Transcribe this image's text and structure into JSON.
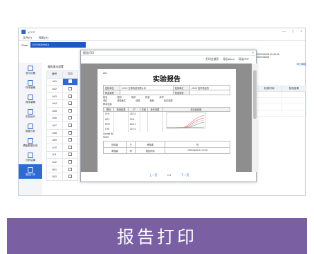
{
  "app": {
    "title": "qPCR",
    "window_controls": [
      "—",
      "□",
      "×"
    ],
    "menu": [
      "文件(F)",
      "帮助(H)"
    ],
    "barcode_label": "Plate",
    "barcode_value": "2022060894601"
  },
  "sidebar": {
    "items": [
      {
        "label": "显示设置",
        "active": false
      },
      {
        "label": "样本编辑",
        "active": false
      },
      {
        "label": "程序编辑",
        "active": false
      },
      {
        "label": "实验运行",
        "active": false
      },
      {
        "label": "数据分析",
        "active": false
      },
      {
        "label": "模板数据分析",
        "active": false
      },
      {
        "label": "分析结果",
        "active": false
      },
      {
        "label": "报告打印",
        "active": true
      }
    ]
  },
  "wells": {
    "header": "报告显示设置",
    "col_well": "编号",
    "col_print": "打印",
    "rows": [
      {
        "id": "A01",
        "selected": true
      },
      {
        "id": "A02",
        "selected": false
      },
      {
        "id": "A03",
        "selected": false
      },
      {
        "id": "A04",
        "selected": false
      },
      {
        "id": "A05",
        "selected": false
      },
      {
        "id": "A06",
        "selected": false
      },
      {
        "id": "A07",
        "selected": false
      },
      {
        "id": "A08",
        "selected": false
      },
      {
        "id": "A09",
        "selected": false
      },
      {
        "id": "A10",
        "selected": false
      },
      {
        "id": "A11",
        "selected": false
      },
      {
        "id": "A12",
        "selected": false
      },
      {
        "id": "B01",
        "selected": false
      },
      {
        "id": "B02",
        "selected": false
      }
    ]
  },
  "right_panel": {
    "timestamp_1": "2022/06/08 09:45:39",
    "timestamp_2": "2022/06/08",
    "print_label": "导出模板",
    "col_a": "检测时间",
    "col_b": "检测结果"
  },
  "dialog": {
    "title": "报告打印",
    "close": "×",
    "toolbar": [
      "打印全部页",
      "导出Word",
      "导出PDF"
    ],
    "page_header": "A01",
    "doc_title": "实验报告",
    "info_rows": [
      [
        "送检单位",
        "XXXX 生物科技有限公司",
        "检测单位",
        "XXXX 医学检验所"
      ],
      [
        "样品类型",
        "",
        "检测类型",
        ""
      ]
    ],
    "patient_line_1": [
      "姓名",
      "性别",
      "年龄",
      "科室",
      "床号"
    ],
    "patient_line_2": [
      "单位",
      "送检医生",
      "送检",
      "检验",
      "标本类型"
    ],
    "sample_info": "样本信息",
    "results_headers": [
      "靶标",
      "检测结果",
      "CT",
      "浓度",
      "参考范围",
      "荧光曲线图"
    ],
    "results_rows": [
      [
        "CH1",
        "",
        "28.74",
        "",
        ""
      ],
      [
        "HE1",
        "",
        "23.6",
        "",
        ""
      ],
      [
        "ROX",
        "",
        "26.01",
        "",
        ""
      ],
      [
        "CY5",
        "",
        "20.74",
        "",
        ""
      ]
    ],
    "conclusion_label": "Overall Re",
    "conclusion_value": "PASS",
    "sign_rows": [
      [
        "检验者",
        "王",
        "审核者",
        "何"
      ],
      [
        "审核者",
        "李",
        "报告时间",
        "2022/06/08 11:37:25"
      ]
    ],
    "pager": {
      "prev": "上一页",
      "page": "1/1",
      "next": "下一页"
    }
  },
  "caption": "报告打印",
  "colors": {
    "accent": "#2f6ad0",
    "caption_bg": "#7a5fa3"
  }
}
